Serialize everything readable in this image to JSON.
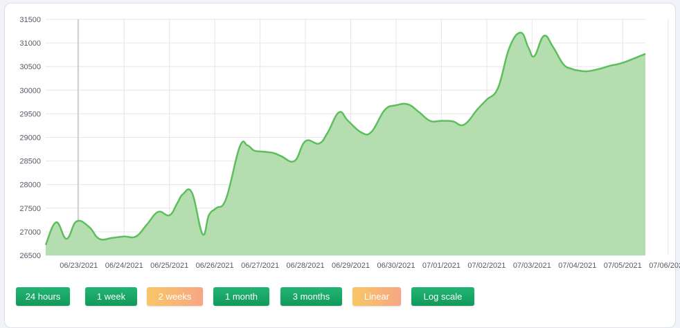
{
  "chart_data": {
    "type": "area",
    "title": "",
    "xlabel": "",
    "ylabel": "",
    "ylim": [
      26500,
      31500
    ],
    "yticks": [
      26500,
      27000,
      27500,
      28000,
      28500,
      29000,
      29500,
      30000,
      30500,
      31000,
      31500
    ],
    "xtick_labels": [
      "06/23/2021",
      "06/24/2021",
      "06/25/2021",
      "06/26/2021",
      "06/27/2021",
      "06/28/2021",
      "06/29/2021",
      "06/30/2021",
      "07/01/2021",
      "07/02/2021",
      "07/03/2021",
      "07/04/2021",
      "07/05/2021",
      "07/06/2021"
    ],
    "x_range_days": [
      -0.73,
      12.5
    ],
    "grid": true,
    "colors": {
      "line": "#5cbf5c",
      "fill": "#b5deb0",
      "grid": "#e6e6ea",
      "crosshair": "#b0b0b0"
    },
    "series": [
      {
        "x": [
          -0.73,
          -0.5,
          -0.27,
          -0.05,
          0.23,
          0.45,
          0.74,
          1.0,
          1.26,
          1.5,
          1.75,
          2.0,
          2.17,
          2.3,
          2.5,
          2.73,
          2.87,
          3.03,
          3.25,
          3.55,
          3.72,
          3.87,
          4.04,
          4.29,
          4.47,
          4.76,
          5.0,
          5.3,
          5.49,
          5.74,
          5.94,
          6.24,
          6.46,
          6.75,
          7.0,
          7.26,
          7.5,
          7.75,
          8.0,
          8.25,
          8.5,
          8.8,
          9.0,
          9.25,
          9.5,
          9.75,
          9.92,
          10.05,
          10.26,
          10.46,
          10.69,
          10.88,
          11.0,
          11.22,
          11.48,
          11.73,
          12.0,
          12.5
        ],
        "y": [
          26720,
          27200,
          26850,
          27220,
          27100,
          26850,
          26870,
          26900,
          26900,
          27150,
          27420,
          27350,
          27600,
          27800,
          27820,
          26950,
          27350,
          27500,
          27700,
          28800,
          28830,
          28720,
          28700,
          28670,
          28600,
          28500,
          28920,
          28870,
          29100,
          29530,
          29350,
          29100,
          29120,
          29580,
          29680,
          29700,
          29540,
          29350,
          29350,
          29340,
          29270,
          29600,
          29800,
          30050,
          30900,
          31220,
          30900,
          30720,
          31150,
          30920,
          30550,
          30450,
          30420,
          30400,
          30450,
          30520,
          30580,
          30770
        ]
      }
    ]
  },
  "buttons": [
    {
      "label": "24 hours",
      "style": "green"
    },
    {
      "label": "1 week",
      "style": "green"
    },
    {
      "label": "2 weeks",
      "style": "orange"
    },
    {
      "label": "1 month",
      "style": "green"
    },
    {
      "label": "3 months",
      "style": "green"
    },
    {
      "label": "Linear",
      "style": "orange"
    },
    {
      "label": "Log scale",
      "style": "green"
    }
  ]
}
